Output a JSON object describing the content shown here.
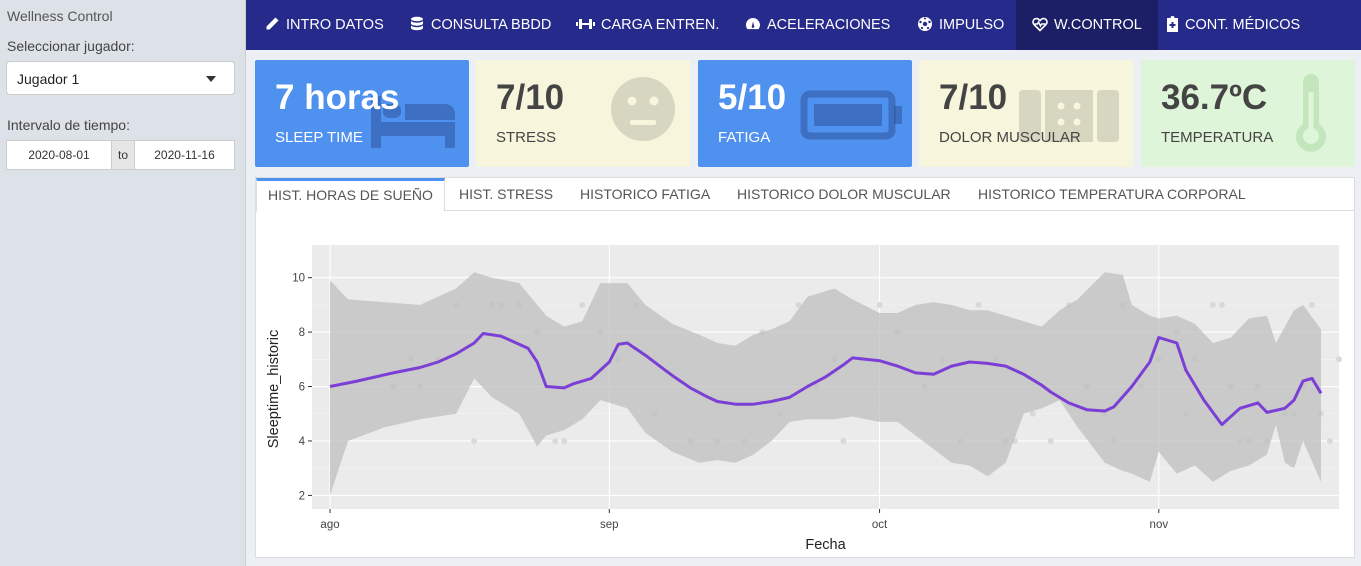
{
  "sidebar": {
    "title": "Wellness Control",
    "player_label": "Seleccionar jugador:",
    "player_value": "Jugador 1",
    "interval_label": "Intervalo de tiempo:",
    "date_start": "2020-08-01",
    "date_sep": "to",
    "date_end": "2020-11-16"
  },
  "nav": [
    {
      "label": "INTRO DATOS",
      "icon": "pencil-icon"
    },
    {
      "label": "CONSULTA BBDD",
      "icon": "database-icon"
    },
    {
      "label": "CARGA ENTREN.",
      "icon": "dumbbell-icon"
    },
    {
      "label": "ACELERACIONES",
      "icon": "tachometer-icon"
    },
    {
      "label": "IMPULSO",
      "icon": "futbol-icon"
    },
    {
      "label": "W.CONTROL",
      "icon": "heartbeat-icon"
    },
    {
      "label": "CONT. MÉDICOS",
      "icon": "medical-file-icon"
    }
  ],
  "value_boxes": [
    {
      "value": "7 horas",
      "label": "SLEEP TIME",
      "icon": "bed-icon",
      "color": "#4f91ee"
    },
    {
      "value": "7/10",
      "label": "STRESS",
      "icon": "meh-face-icon",
      "color": "#f7f6dc"
    },
    {
      "value": "5/10",
      "label": "FATIGA",
      "icon": "battery-icon",
      "color": "#4f91ee"
    },
    {
      "value": "7/10",
      "label": "DOLOR MUSCULAR",
      "icon": "bandaid-icon",
      "color": "#f7f6dc"
    },
    {
      "value": "36.7ºC",
      "label": "TEMPERATURA",
      "icon": "thermometer-icon",
      "color": "#dff5d9"
    }
  ],
  "tabs": [
    {
      "label": "HIST. HORAS DE SUEÑO",
      "active": true
    },
    {
      "label": "HIST. STRESS",
      "active": false
    },
    {
      "label": "HISTORICO FATIGA",
      "active": false
    },
    {
      "label": "HISTORICO DOLOR MUSCULAR",
      "active": false
    },
    {
      "label": "HISTORICO TEMPERATURA CORPORAL",
      "active": false
    }
  ],
  "chart_data": {
    "type": "line",
    "xlabel": "Fecha",
    "ylabel": "Sleeptime_historic",
    "x_ticks": [
      {
        "label": "ago",
        "day": 0
      },
      {
        "label": "sep",
        "day": 31
      },
      {
        "label": "oct",
        "day": 61
      },
      {
        "label": "nov",
        "day": 92
      }
    ],
    "y_ticks": [
      2,
      4,
      6,
      8,
      10
    ],
    "ylim": [
      1.5,
      11.2
    ],
    "xlim_days": [
      -2,
      112
    ],
    "smooth_color": "#7b3fd6",
    "ribbon_color": "#bdbdbd",
    "smooth": {
      "x": [
        0,
        3,
        7,
        10,
        12,
        14,
        16,
        17,
        19,
        20,
        22,
        23,
        24,
        26,
        27,
        29,
        31,
        32,
        33,
        35,
        37,
        38,
        40,
        42,
        43,
        45,
        47,
        49,
        51,
        53,
        55,
        57,
        58,
        61,
        63,
        65,
        67,
        69,
        71,
        73,
        75,
        77,
        79,
        80,
        82,
        84,
        86,
        87,
        89,
        91,
        92,
        94,
        95,
        97,
        99,
        101,
        103,
        104,
        106,
        107,
        108,
        109,
        110
      ],
      "y": [
        6.0,
        6.2,
        6.5,
        6.7,
        6.9,
        7.2,
        7.6,
        7.95,
        7.85,
        7.7,
        7.4,
        6.9,
        6.0,
        5.95,
        6.1,
        6.3,
        6.9,
        7.55,
        7.6,
        7.15,
        6.65,
        6.4,
        5.95,
        5.6,
        5.45,
        5.35,
        5.35,
        5.45,
        5.6,
        6.0,
        6.35,
        6.8,
        7.05,
        6.95,
        6.75,
        6.5,
        6.45,
        6.75,
        6.9,
        6.85,
        6.75,
        6.45,
        6.05,
        5.8,
        5.4,
        5.15,
        5.1,
        5.25,
        6.0,
        6.9,
        7.8,
        7.6,
        6.6,
        5.5,
        4.6,
        5.2,
        5.4,
        5.05,
        5.2,
        5.5,
        6.2,
        6.3,
        5.75
      ]
    },
    "band_upper": [
      9.9,
      9.2,
      9.1,
      9.0,
      9.6,
      10.2,
      10.0,
      9.8,
      9.0,
      8.6,
      8.2,
      8.4,
      9.8,
      9.8,
      9.0,
      8.3,
      7.9,
      7.6,
      7.5,
      7.9,
      8.1,
      8.4,
      9.3,
      9.6,
      9.2,
      8.7,
      8.7,
      9.0,
      9.1,
      9.0,
      8.8,
      8.8,
      8.6,
      8.4,
      8.2,
      8.8,
      9.2,
      10.2,
      10.1,
      9.0,
      8.6,
      8.5,
      8.6,
      8.3,
      7.6,
      7.8,
      8.5,
      8.6,
      7.6,
      8.2,
      8.8,
      9.0,
      8.1
    ],
    "band_lower": [
      2.0,
      4.0,
      4.5,
      4.8,
      5.0,
      6.3,
      5.6,
      5.0,
      3.8,
      4.2,
      4.4,
      4.8,
      5.5,
      5.2,
      4.3,
      3.6,
      3.2,
      3.3,
      3.2,
      3.5,
      4.0,
      4.7,
      4.8,
      4.8,
      4.9,
      4.7,
      4.7,
      4.2,
      3.7,
      3.2,
      3.1,
      2.7,
      3.2,
      5.0,
      5.2,
      5.5,
      4.5,
      3.2,
      2.9,
      2.8,
      2.5,
      3.6,
      2.8,
      3.1,
      2.5,
      2.9,
      3.1,
      3.5,
      4.6,
      3.2,
      3.0,
      4.0,
      2.5
    ],
    "band_x": [
      0,
      2,
      6,
      10,
      14,
      16,
      18,
      21,
      23,
      24,
      26,
      28,
      30,
      33,
      35,
      38,
      41,
      43,
      45,
      47,
      49,
      51,
      53,
      56,
      58,
      61,
      63,
      65,
      67,
      69,
      71,
      73,
      75,
      77,
      79,
      81,
      83,
      86,
      88,
      89,
      91,
      92,
      94,
      96,
      98,
      100,
      102,
      104,
      105,
      106,
      107,
      108,
      110
    ],
    "points": {
      "x": [
        7,
        9,
        10,
        12,
        14,
        16,
        18,
        19,
        21,
        23,
        25,
        26,
        28,
        30,
        32,
        34,
        36,
        40,
        43,
        46,
        48,
        50,
        52,
        54,
        56,
        57,
        59,
        61,
        63,
        66,
        68,
        70,
        72,
        74,
        75,
        76,
        78,
        80,
        82,
        84,
        86,
        87,
        88,
        90,
        92,
        94,
        95,
        96,
        98,
        99,
        100,
        101,
        102,
        103,
        104,
        106,
        107,
        108,
        109,
        110,
        111,
        112
      ],
      "y": [
        6,
        7,
        6,
        7,
        9,
        4,
        9,
        9,
        9,
        8,
        4,
        4,
        9,
        8,
        7,
        9,
        5,
        4,
        4,
        4,
        8,
        5,
        9,
        6,
        7,
        4,
        7,
        9,
        8,
        6,
        7,
        4,
        9,
        7,
        4,
        4,
        5,
        4,
        9,
        6,
        5,
        4,
        9,
        6,
        7,
        8,
        5,
        7,
        9,
        9,
        6,
        4,
        4,
        6,
        4,
        5,
        5,
        6,
        9,
        5,
        4,
        7
      ]
    }
  }
}
